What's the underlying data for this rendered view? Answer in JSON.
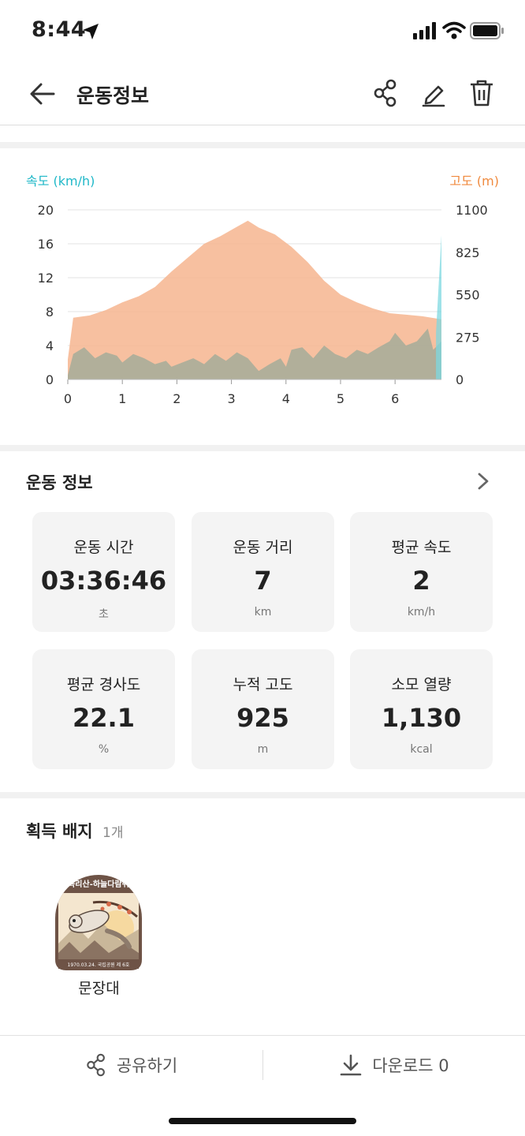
{
  "status_bar": {
    "time": "8:44"
  },
  "header": {
    "title": "운동정보",
    "icons": [
      "back-arrow-icon",
      "share-icon",
      "edit-icon",
      "trash-icon"
    ]
  },
  "chart_data": {
    "type": "area",
    "left_axis_label": "속도 (km/h)",
    "right_axis_label": "고도 (m)",
    "x_ticks": [
      "0",
      "1",
      "2",
      "3",
      "4",
      "5",
      "6"
    ],
    "y_left_ticks": [
      "20",
      "16",
      "12",
      "8",
      "4",
      "0"
    ],
    "y_right_ticks": [
      "1100",
      "825",
      "550",
      "275",
      "0"
    ],
    "xlim": [
      0,
      6.85
    ],
    "ylim_left": [
      0,
      20
    ],
    "ylim_right": [
      0,
      1100
    ],
    "series": [
      {
        "axis": "right",
        "color": "#f6b58f",
        "x": [
          0,
          0.1,
          0.4,
          0.7,
          1.0,
          1.3,
          1.6,
          1.9,
          2.2,
          2.5,
          2.8,
          3.1,
          3.3,
          3.5,
          3.8,
          4.1,
          4.4,
          4.7,
          5.0,
          5.3,
          5.6,
          5.9,
          6.2,
          6.5,
          6.85
        ],
        "values": [
          130,
          400,
          415,
          450,
          500,
          540,
          600,
          700,
          790,
          880,
          930,
          990,
          1030,
          985,
          940,
          860,
          760,
          640,
          550,
          500,
          460,
          430,
          420,
          410,
          390
        ]
      },
      {
        "axis": "left",
        "color": "#9aa998",
        "x": [
          0,
          0.1,
          0.3,
          0.5,
          0.7,
          0.9,
          1.0,
          1.2,
          1.4,
          1.6,
          1.8,
          1.9,
          2.1,
          2.3,
          2.5,
          2.7,
          2.9,
          3.1,
          3.3,
          3.5,
          3.7,
          3.9,
          4.0,
          4.1,
          4.3,
          4.5,
          4.7,
          4.9,
          5.1,
          5.3,
          5.5,
          5.7,
          5.9,
          6.0,
          6.2,
          6.4,
          6.6,
          6.7,
          6.85
        ],
        "values": [
          0.5,
          3.0,
          3.8,
          2.5,
          3.2,
          2.8,
          2.0,
          3.0,
          2.5,
          1.8,
          2.2,
          1.5,
          2.0,
          2.5,
          1.8,
          3.0,
          2.2,
          3.2,
          2.5,
          1.0,
          1.8,
          2.5,
          1.5,
          3.5,
          3.8,
          2.5,
          4.0,
          3.0,
          2.5,
          3.5,
          3.0,
          3.8,
          4.5,
          5.5,
          4.0,
          4.5,
          6.0,
          3.5,
          4.5
        ]
      },
      {
        "axis": "left",
        "color": "#7ed8e0",
        "x": [
          6.75,
          6.85
        ],
        "values": [
          5.5,
          17
        ]
      }
    ]
  },
  "stats": {
    "title": "운동 정보",
    "cards": [
      {
        "label": "운동 시간",
        "value": "03:36:46",
        "unit": "초"
      },
      {
        "label": "운동 거리",
        "value": "7",
        "unit": "km"
      },
      {
        "label": "평균 속도",
        "value": "2",
        "unit": "km/h"
      },
      {
        "label": "평균 경사도",
        "value": "22.1",
        "unit": "%"
      },
      {
        "label": "누적 고도",
        "value": "925",
        "unit": "m"
      },
      {
        "label": "소모 열량",
        "value": "1,130",
        "unit": "kcal"
      }
    ]
  },
  "badges": {
    "title": "획득 배지",
    "count": "1개",
    "items": [
      {
        "name": "문장대",
        "badge_text": "속리산-하늘다람쥐",
        "badge_caption": "1970.03.24. 국립공원 제 6호"
      }
    ]
  },
  "bottom": {
    "share_label": "공유하기",
    "download_label": "다운로드 0"
  },
  "colors": {
    "speed": "#1fb8c8",
    "altitude": "#f08a3e"
  }
}
